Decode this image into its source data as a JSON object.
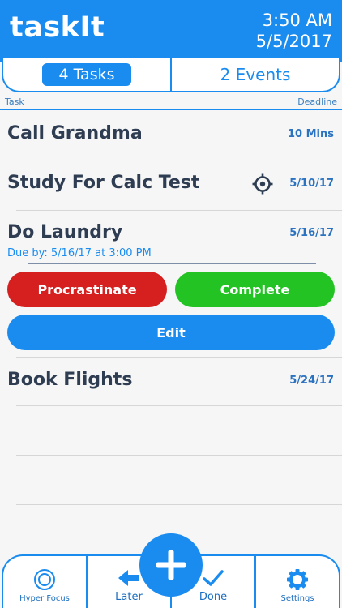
{
  "header": {
    "logo": "taskIt",
    "time": "3:50 AM",
    "date": "5/5/2017"
  },
  "tabs": [
    {
      "label": "4 Tasks",
      "active": true
    },
    {
      "label": "2 Events",
      "active": false
    }
  ],
  "columns": {
    "task": "Task",
    "deadline": "Deadline"
  },
  "tasks": [
    {
      "title": "Call Grandma",
      "deadline": "10 Mins"
    },
    {
      "title": "Study For Calc Test",
      "deadline": "5/10/17",
      "icon": "target-icon"
    },
    {
      "title": "Do Laundry",
      "deadline": "5/16/17",
      "due": "Due by: 5/16/17 at 3:00 PM",
      "expanded": true
    },
    {
      "title": "Book Flights",
      "deadline": "5/24/17"
    }
  ],
  "actions": {
    "procrastinate": "Procrastinate",
    "complete": "Complete",
    "edit": "Edit"
  },
  "bottom_nav": {
    "hyper_focus": "Hyper Focus",
    "later": "Later",
    "add_icon": "plus-icon",
    "done": "Done",
    "settings": "Settings"
  },
  "colors": {
    "accent": "#1a8cf0",
    "danger": "#d62020",
    "success": "#22c322",
    "text": "#2f3d52"
  }
}
